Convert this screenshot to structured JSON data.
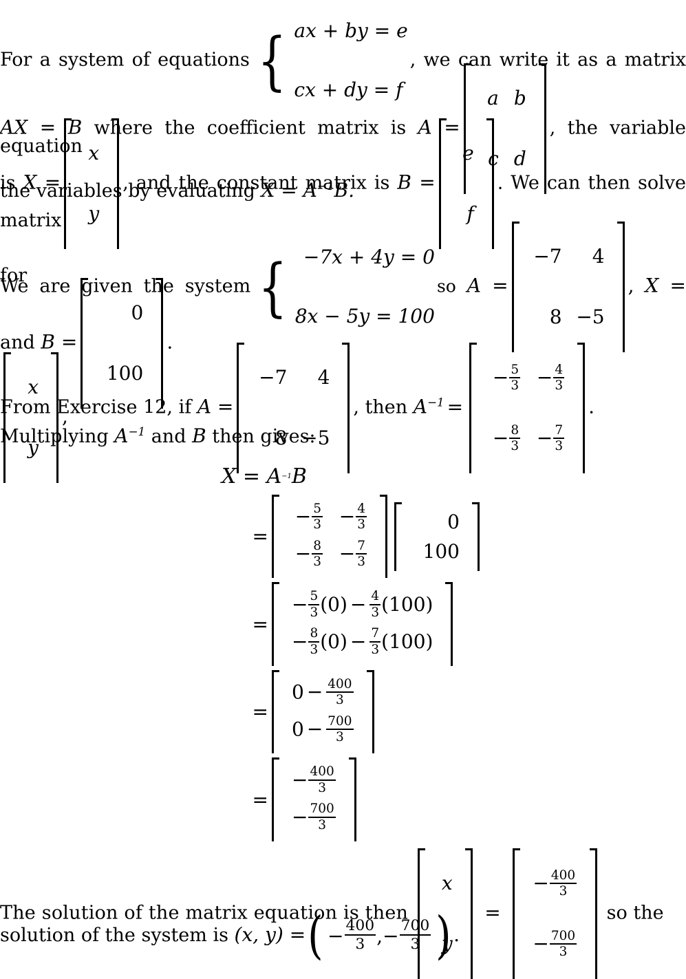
{
  "document": {
    "type": "math-solution",
    "background_color": "#ffffff",
    "text_color": "#000000"
  },
  "intro": {
    "s1": "For a system of equations",
    "system_generic": {
      "eq1": "ax + by = e",
      "eq2": "cx + dy = f"
    },
    "s2": ", we can write it as a matrix equation",
    "s3": "AX = B",
    "s4": " where the coefficient matrix is ",
    "s5": "A =",
    "matrix_A_generic": {
      "rows": [
        [
          "a",
          "b"
        ],
        [
          "c",
          "d"
        ]
      ]
    },
    "s6": ", the variable matrix",
    "s7": "is",
    "s8": "X =",
    "matrix_X_generic": {
      "rows": [
        [
          "x"
        ],
        [
          "y"
        ]
      ]
    },
    "s9": ", and the constant matrix is ",
    "s10": "B =",
    "matrix_B_generic": {
      "rows": [
        [
          "e"
        ],
        [
          "f"
        ]
      ]
    },
    "s11": ". We can then solve for",
    "s12": "the variables by evaluating ",
    "s13": "X = A",
    "s13_exp": "−1",
    "s14": "B."
  },
  "given": {
    "s1": "We are given the system",
    "system": {
      "eq1": "−7x + 4y = 0",
      "eq2": "8x − 5y = 100"
    },
    "s2": "so",
    "s3": "A =",
    "matrix_A": {
      "rows": [
        [
          "−7",
          "4"
        ],
        [
          "8",
          "−5"
        ]
      ]
    },
    "s4": ",",
    "s5": "X =",
    "matrix_X": {
      "rows": [
        [
          "x"
        ],
        [
          "y"
        ]
      ]
    },
    "s6": ",",
    "s7": "and",
    "s8": "B =",
    "matrix_B": {
      "rows": [
        [
          "0"
        ],
        [
          "100"
        ]
      ]
    },
    "s9": "."
  },
  "inverse": {
    "s1": "From Exercise 12, if ",
    "s2": "A =",
    "matrix_A": {
      "rows": [
        [
          "−7",
          "4"
        ],
        [
          "8",
          "−5"
        ]
      ]
    },
    "s3": ", then ",
    "s4": "A",
    "s4_exp": "−1",
    "s5": "=",
    "matrix_Ainv": {
      "rows": [
        [
          {
            "sign": "−",
            "n": "5",
            "d": "3"
          },
          {
            "sign": "−",
            "n": "4",
            "d": "3"
          }
        ],
        [
          {
            "sign": "−",
            "n": "8",
            "d": "3"
          },
          {
            "sign": "−",
            "n": "7",
            "d": "3"
          }
        ]
      ]
    },
    "s6": "."
  },
  "multiply": {
    "heading_a": "Multiplying ",
    "heading_b": "A",
    "heading_b_exp": "−1",
    "heading_c": " and ",
    "heading_d": "B",
    "heading_e": " then gives:",
    "line1": {
      "lead": "",
      "expr": "X = A",
      "expr_exp": "−1",
      "expr_tail": "B"
    },
    "line2": {
      "lead": "=",
      "matrix_left": {
        "rows": [
          [
            {
              "sign": "−",
              "n": "5",
              "d": "3"
            },
            {
              "sign": "−",
              "n": "4",
              "d": "3"
            }
          ],
          [
            {
              "sign": "−",
              "n": "8",
              "d": "3"
            },
            {
              "sign": "−",
              "n": "7",
              "d": "3"
            }
          ]
        ]
      },
      "matrix_right": {
        "rows": [
          [
            "0"
          ],
          [
            "100"
          ]
        ]
      }
    },
    "line3": {
      "lead": "=",
      "rows": [
        {
          "sign": "−",
          "n": "5",
          "d": "3",
          "mul1": "(0)",
          "op": "−",
          "n2": "4",
          "d2": "3",
          "mul2": "(100)"
        },
        {
          "sign": "−",
          "n": "8",
          "d": "3",
          "mul1": "(0)",
          "op": "−",
          "n2": "7",
          "d2": "3",
          "mul2": "(100)"
        }
      ]
    },
    "line4": {
      "lead": "=",
      "rows": [
        {
          "lhs": "0",
          "op": "−",
          "n": "400",
          "d": "3"
        },
        {
          "lhs": "0",
          "op": "−",
          "n": "700",
          "d": "3"
        }
      ]
    },
    "line5": {
      "lead": "=",
      "rows": [
        {
          "sign": "−",
          "n": "400",
          "d": "3"
        },
        {
          "sign": "−",
          "n": "700",
          "d": "3"
        }
      ]
    }
  },
  "conclusion": {
    "s1": "The  solution  of  the  matrix  equation  is  then",
    "matrix_X": {
      "rows": [
        [
          "x"
        ],
        [
          "y"
        ]
      ]
    },
    "s2": "=",
    "matrix_result": {
      "rows": [
        {
          "sign": "−",
          "n": "400",
          "d": "3"
        },
        {
          "sign": "−",
          "n": "700",
          "d": "3"
        }
      ]
    },
    "s3": "so  the",
    "s4": "solution of the system is ",
    "s5": "(x, y) =",
    "ordered_pair": {
      "x": {
        "sign": "−",
        "n": "400",
        "d": "3"
      },
      "comma": ",",
      "y": {
        "sign": "−",
        "n": "700",
        "d": "3"
      }
    },
    "s6": "."
  }
}
